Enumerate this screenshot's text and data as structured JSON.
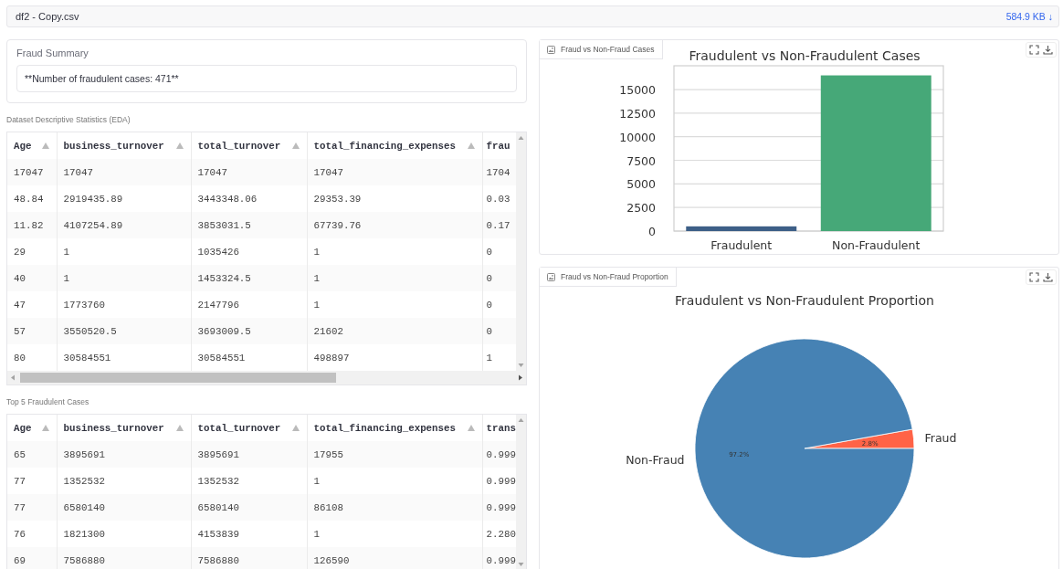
{
  "file_bar": {
    "name": "df2 - Copy.csv",
    "size": "584.9 KB ↓"
  },
  "summary": {
    "title": "Fraud Summary",
    "message": "**Number of fraudulent cases: 471**"
  },
  "tables": [
    {
      "caption": "Dataset Descriptive Statistics (EDA)",
      "columns": [
        "Age",
        "business_turnover",
        "total_turnover",
        "total_financing_expenses",
        "frau"
      ],
      "horizontal_scrollbar": true,
      "rows": [
        [
          "17047",
          "17047",
          "17047",
          "17047",
          "1704"
        ],
        [
          "48.84",
          "2919435.89",
          "3443348.06",
          "29353.39",
          "0.03"
        ],
        [
          "11.82",
          "4107254.89",
          "3853031.5",
          "67739.76",
          "0.17"
        ],
        [
          "29",
          "1",
          "1035426",
          "1",
          "0"
        ],
        [
          "40",
          "1",
          "1453324.5",
          "1",
          "0"
        ],
        [
          "47",
          "1773760",
          "2147796",
          "1",
          "0"
        ],
        [
          "57",
          "3550520.5",
          "3693009.5",
          "21602",
          "0"
        ],
        [
          "80",
          "30584551",
          "30584551",
          "498897",
          "1"
        ]
      ]
    },
    {
      "caption": "Top 5 Fraudulent Cases",
      "columns": [
        "Age",
        "business_turnover",
        "total_turnover",
        "total_financing_expenses",
        "trans"
      ],
      "horizontal_scrollbar": false,
      "rows": [
        [
          "65",
          "3895691",
          "3895691",
          "17955",
          "0.999"
        ],
        [
          "77",
          "1352532",
          "1352532",
          "1",
          "0.999"
        ],
        [
          "77",
          "6580140",
          "6580140",
          "86108",
          "0.999"
        ],
        [
          "76",
          "1821300",
          "4153839",
          "1",
          "2.280"
        ],
        [
          "69",
          "7586880",
          "7586880",
          "126590",
          "0.999"
        ]
      ]
    }
  ],
  "charts": [
    {
      "tab": "Fraud vs Non-Fraud Cases",
      "chart_data": {
        "type": "bar",
        "title": "Fraudulent vs Non-Fraudulent Cases",
        "categories": [
          "Fraudulent",
          "Non-Fraudulent"
        ],
        "series": [
          {
            "values": [
              500,
              16500
            ],
            "colors": [
              "#3d5f87",
              "#46a878"
            ]
          }
        ],
        "grid": true,
        "ylim": [
          0,
          17520
        ],
        "yticks": [
          0,
          2500,
          5000,
          7500,
          10000,
          12500,
          15000
        ]
      }
    },
    {
      "tab": "Fraud vs Non-Fraud Proportion",
      "chart_data": {
        "type": "pie",
        "title": "Fraudulent vs Non-Fraudulent Proportion",
        "categories": [
          "Fraud",
          "Non-Fraud"
        ],
        "series": [
          {
            "values": [
              2.8,
              97.2
            ],
            "colors": [
              "#ff6347",
              "#4682b4"
            ]
          }
        ],
        "value_labels": [
          "2.8%",
          "97.2%"
        ]
      }
    }
  ]
}
